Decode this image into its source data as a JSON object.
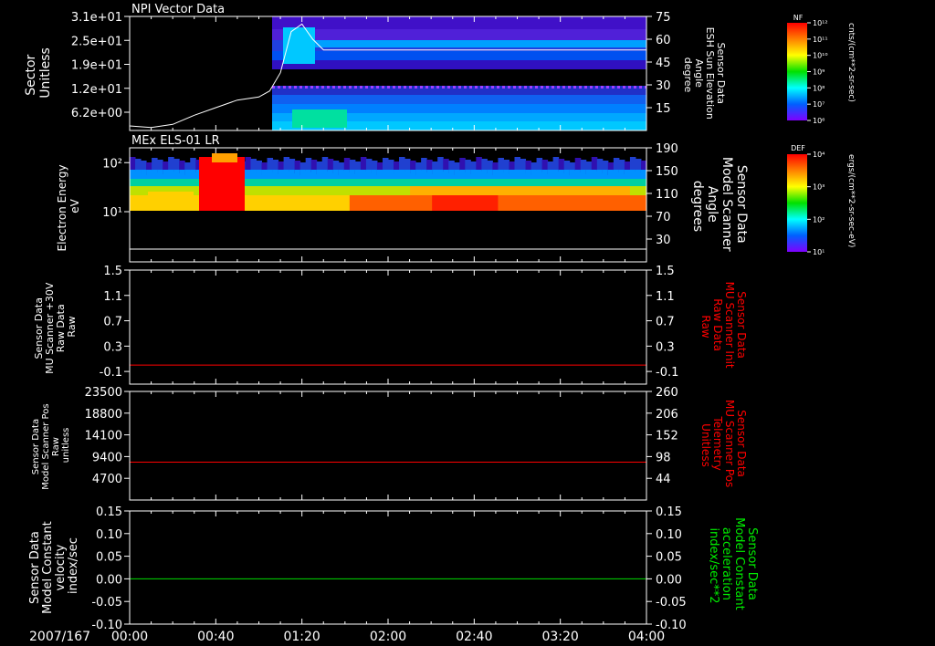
{
  "time_axis": {
    "date_label": "2007/167",
    "ticks": [
      "00:00",
      "00:40",
      "01:20",
      "02:00",
      "02:40",
      "03:20",
      "04:00"
    ]
  },
  "colorbars": [
    {
      "title": "NF",
      "units": "cnts/(cm**2-sr-sec)",
      "tick_labels": [
        "10¹²",
        "10¹¹",
        "10¹⁰",
        "10⁹",
        "10⁸",
        "10⁷",
        "10⁶"
      ],
      "colors": [
        "#ff0000",
        "#ff8000",
        "#ffff00",
        "#00e000",
        "#00ffff",
        "#0060ff",
        "#8000ff"
      ]
    },
    {
      "title": "DEF",
      "units": "ergs/(cm**2-sr-sec-eV)",
      "tick_labels": [
        "10⁴",
        "10³",
        "10²",
        "10¹"
      ],
      "colors": [
        "#ff0000",
        "#ff8000",
        "#ffff00",
        "#00e000",
        "#00ffff",
        "#0060ff",
        "#8000ff"
      ]
    }
  ],
  "chart_data": [
    {
      "type": "heatmap",
      "title": "NPI Vector Data",
      "ylabel_left": [
        "Sector",
        "Unitless"
      ],
      "ylabel_right": [
        "Sensor Data",
        "ESH Sun Elevation",
        "Angle",
        "degree"
      ],
      "left_ticks": [
        "3.1e+01",
        "2.5e+01",
        "1.9e+01",
        "1.2e+01",
        "6.2e+00"
      ],
      "right_ticks": [
        "75",
        "60",
        "45",
        "30",
        "15"
      ],
      "data_start_time": "01:02",
      "overlay_line": {
        "color": "#ffffff",
        "x_minutes": [
          0,
          10,
          20,
          30,
          40,
          50,
          60,
          65,
          70,
          75,
          80,
          85,
          90,
          100,
          120,
          150,
          180,
          210,
          240
        ],
        "y_degrees": [
          3,
          2,
          4,
          10,
          15,
          20,
          22,
          26,
          38,
          65,
          70,
          60,
          53,
          53,
          53,
          53,
          53,
          53,
          53
        ]
      }
    },
    {
      "type": "heatmap",
      "title": "MEx ELS-01 LR",
      "ylabel_left": [
        "Electron Energy",
        "eV"
      ],
      "ylabel_right": [
        "Sensor Data",
        "Model Scanner",
        "Angle",
        "degrees"
      ],
      "left_ticks": [
        "10²",
        "10¹"
      ],
      "right_ticks": [
        "190",
        "150",
        "110",
        "70",
        "30"
      ],
      "overlay_line": {
        "color": "#ffffff",
        "value": 12
      }
    },
    {
      "type": "line",
      "ylabel_left": [
        "Sensor Data",
        "MU Scanner +30V",
        "Raw Data",
        "Raw"
      ],
      "ylabel_right": [
        "Sensor Data",
        "MU Scanner Init",
        "Raw Data",
        "Raw"
      ],
      "right_label_color": "#ff0000",
      "left_ticks": [
        "1.5",
        "1.1",
        "0.7",
        "0.3",
        "-0.1"
      ],
      "right_ticks": [
        "1.5",
        "1.1",
        "0.7",
        "0.3",
        "-0.1"
      ],
      "ylim": [
        -0.3,
        1.5
      ],
      "series": [
        {
          "color": "#ff0000",
          "value": 0.0
        }
      ]
    },
    {
      "type": "line",
      "ylabel_left": [
        "Sensor Data",
        "Model Scanner Pos",
        "Raw",
        "unitless"
      ],
      "ylabel_right": [
        "Sensor Data",
        "MU Scanner Pos",
        "Telemetry",
        "Unitless"
      ],
      "right_label_color": "#ff0000",
      "left_ticks": [
        "23500",
        "18800",
        "14100",
        "9400",
        "4700"
      ],
      "right_ticks": [
        "260",
        "206",
        "152",
        "98",
        "44"
      ],
      "ylim": [
        0,
        23500
      ],
      "series": [
        {
          "color": "#ff0000",
          "value": 8200
        }
      ]
    },
    {
      "type": "line",
      "ylabel_left": [
        "Sensor Data",
        "Model Constant",
        "velocity",
        "index/sec"
      ],
      "ylabel_right": [
        "Sensor Data",
        "Model Constant",
        "acceleration",
        "index/sec**2"
      ],
      "right_label_color": "#00ee00",
      "left_ticks": [
        "0.15",
        "0.10",
        "0.05",
        "0.00",
        "-0.05",
        "-0.10"
      ],
      "right_ticks": [
        "0.15",
        "0.10",
        "0.05",
        "0.00",
        "-0.05",
        "-0.10"
      ],
      "ylim": [
        -0.1,
        0.15
      ],
      "series": [
        {
          "color": "#00dd00",
          "value": 0.0
        }
      ]
    }
  ]
}
